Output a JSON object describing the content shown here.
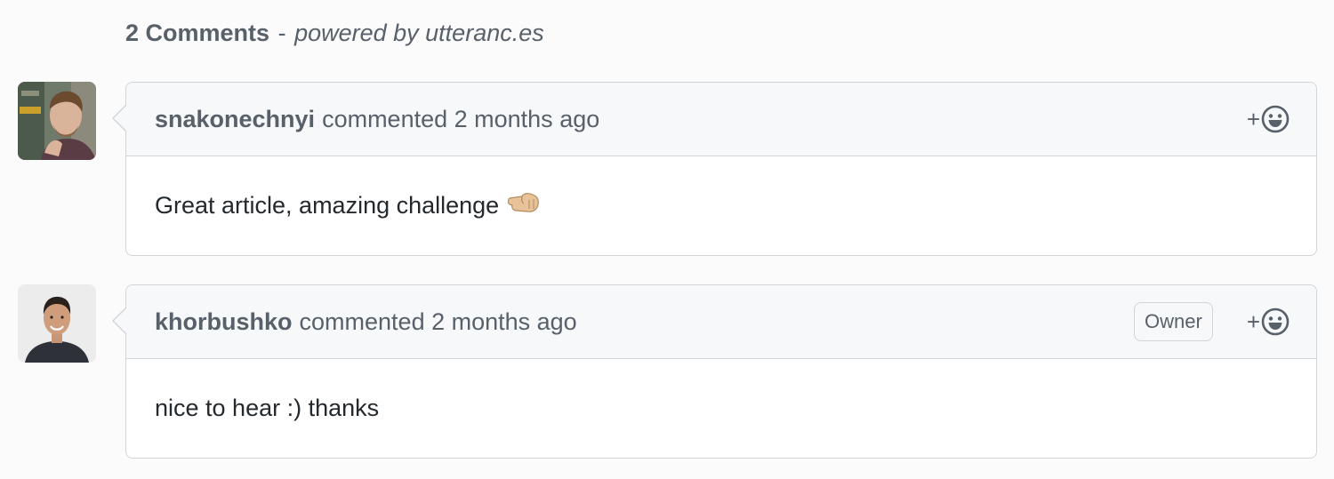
{
  "header": {
    "count_label": "2 Comments",
    "separator": "-",
    "powered_label": "powered by utteranc.es"
  },
  "comments": [
    {
      "author": "snakonechnyi",
      "meta": "commented 2 months ago",
      "body": "Great article, amazing challenge",
      "emoji": "fist-right-emoji",
      "badge": ""
    },
    {
      "author": "khorbushko",
      "meta": "commented 2 months ago",
      "body": "nice to hear :) thanks",
      "badge": "Owner"
    }
  ],
  "reaction_button": {
    "plus": "+",
    "icon": "smiley-icon"
  },
  "colors": {
    "page_bg": "#fbfbfc",
    "header_bg": "#f6f8fa",
    "border": "#d1d5da",
    "muted_text": "#586069",
    "body_text": "#24292e"
  }
}
